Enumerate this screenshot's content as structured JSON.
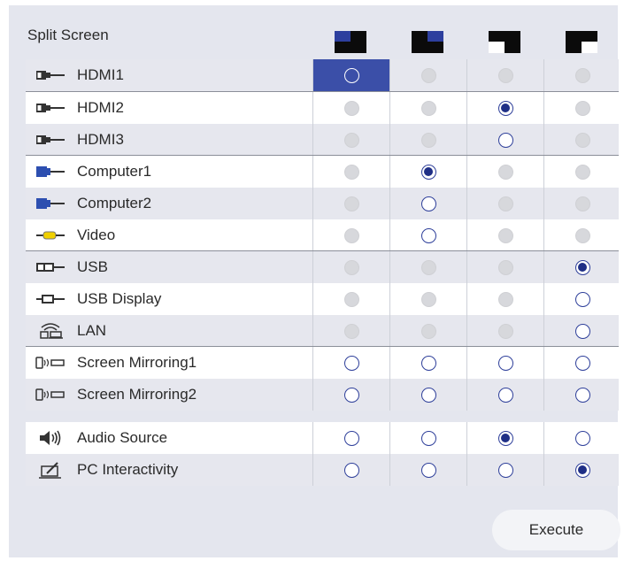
{
  "title": "Split Screen",
  "layout_icons": [
    "layout-top-left-icon",
    "layout-top-right-icon",
    "layout-bottom-left-icon",
    "layout-bottom-right-icon"
  ],
  "rows": [
    {
      "label": "HDMI1",
      "icon": "hdmi-icon",
      "states": [
        "focus-off",
        "disabled",
        "disabled",
        "disabled"
      ]
    },
    {
      "label": "HDMI2",
      "icon": "hdmi-icon",
      "states": [
        "disabled",
        "disabled",
        "on",
        "disabled"
      ]
    },
    {
      "label": "HDMI3",
      "icon": "hdmi-icon",
      "states": [
        "disabled",
        "disabled",
        "off",
        "disabled"
      ]
    },
    {
      "label": "Computer1",
      "icon": "computer-icon",
      "states": [
        "disabled",
        "on",
        "disabled",
        "disabled"
      ]
    },
    {
      "label": "Computer2",
      "icon": "computer-icon",
      "states": [
        "disabled",
        "off",
        "disabled",
        "disabled"
      ]
    },
    {
      "label": "Video",
      "icon": "video-icon",
      "states": [
        "disabled",
        "off",
        "disabled",
        "disabled"
      ]
    },
    {
      "label": "USB",
      "icon": "usb-icon",
      "states": [
        "disabled",
        "disabled",
        "disabled",
        "on"
      ]
    },
    {
      "label": "USB Display",
      "icon": "usb-display-icon",
      "states": [
        "disabled",
        "disabled",
        "disabled",
        "off"
      ]
    },
    {
      "label": "LAN",
      "icon": "lan-icon",
      "states": [
        "disabled",
        "disabled",
        "disabled",
        "off"
      ]
    },
    {
      "label": "Screen Mirroring1",
      "icon": "screen-mirroring-icon",
      "states": [
        "off",
        "off",
        "off",
        "off"
      ]
    },
    {
      "label": "Screen Mirroring2",
      "icon": "screen-mirroring-icon",
      "states": [
        "off",
        "off",
        "off",
        "off"
      ]
    },
    {
      "label": "Audio Source",
      "icon": "speaker-icon",
      "states": [
        "off",
        "off",
        "on",
        "off"
      ]
    },
    {
      "label": "PC Interactivity",
      "icon": "pen-icon",
      "states": [
        "off",
        "off",
        "off",
        "on"
      ]
    }
  ],
  "execute_label": "Execute",
  "colors": {
    "accent": "#3b4fa8",
    "radio": "#1f2f86",
    "panel": "#e4e6ee"
  }
}
